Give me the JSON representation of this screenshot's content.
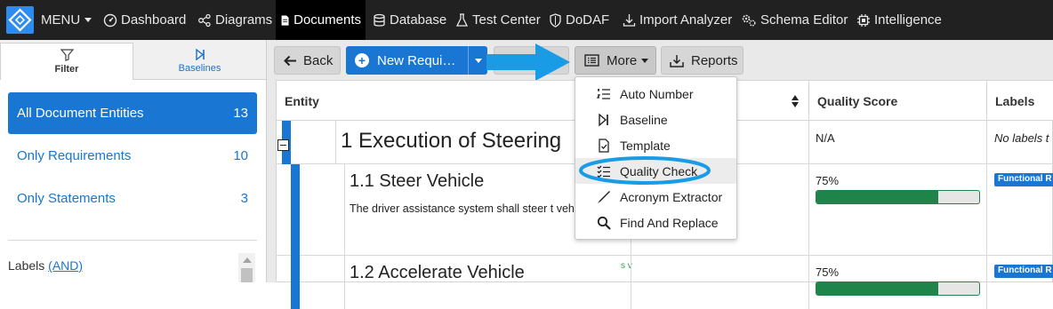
{
  "nav": {
    "menu_label": "MENU",
    "items": [
      {
        "label": "Dashboard",
        "icon": "dashboard-icon"
      },
      {
        "label": "Diagrams",
        "icon": "diagram-icon"
      },
      {
        "label": "Documents",
        "icon": "document-icon",
        "active": true
      },
      {
        "label": "Database",
        "icon": "database-icon"
      },
      {
        "label": "Test Center",
        "icon": "flask-icon"
      },
      {
        "label": "DoDAF",
        "icon": "shield-icon"
      },
      {
        "label": "Import Analyzer",
        "icon": "import-icon"
      },
      {
        "label": "Schema Editor",
        "icon": "gears-icon"
      },
      {
        "label": "Intelligence",
        "icon": "chip-icon"
      }
    ]
  },
  "sidebar": {
    "tabs": [
      {
        "label": "Filter",
        "icon": "filter-icon",
        "active": true
      },
      {
        "label": "Baselines",
        "icon": "baseline-icon"
      }
    ],
    "entities": [
      {
        "label": "All Document Entities",
        "count": "13",
        "selected": true
      },
      {
        "label": "Only Requirements",
        "count": "10"
      },
      {
        "label": "Only Statements",
        "count": "3"
      }
    ],
    "labels_title": "Labels",
    "labels_mode": "(AND)"
  },
  "toolbar": {
    "back_label": "Back",
    "new_label": "New Requi…",
    "more_label": "More",
    "reports_label": "Reports"
  },
  "grid": {
    "headers": {
      "entity": "Entity",
      "quality": "Quality Score",
      "labels": "Labels"
    },
    "rows": [
      {
        "title": "1 Execution of Steering",
        "quality": "N/A",
        "labels": "No labels t"
      },
      {
        "title": "1.1 Steer Vehicle",
        "description": "The driver assistance system shall steer t vehicle.",
        "quality": "75%",
        "quality_value": 0.75,
        "label_tag": "Functional R"
      },
      {
        "title": "1.2 Accelerate Vehicle",
        "side_marker": "s v",
        "quality": "75%",
        "quality_value": 0.75,
        "label_tag": "Functional R"
      }
    ]
  },
  "more_menu": {
    "items": [
      {
        "label": "Auto Number",
        "icon": "list-number-icon"
      },
      {
        "label": "Baseline",
        "icon": "baseline-icon"
      },
      {
        "label": "Template",
        "icon": "template-icon"
      },
      {
        "label": "Quality Check",
        "icon": "checklist-icon",
        "highlighted": true
      },
      {
        "label": "Acronym Extractor",
        "icon": "pen-icon"
      },
      {
        "label": "Find And Replace",
        "icon": "search-icon"
      }
    ]
  },
  "colors": {
    "primary": "#1976d2",
    "nav_bg": "#212121",
    "progress": "#1e8449",
    "annotation": "#1a9be6"
  }
}
